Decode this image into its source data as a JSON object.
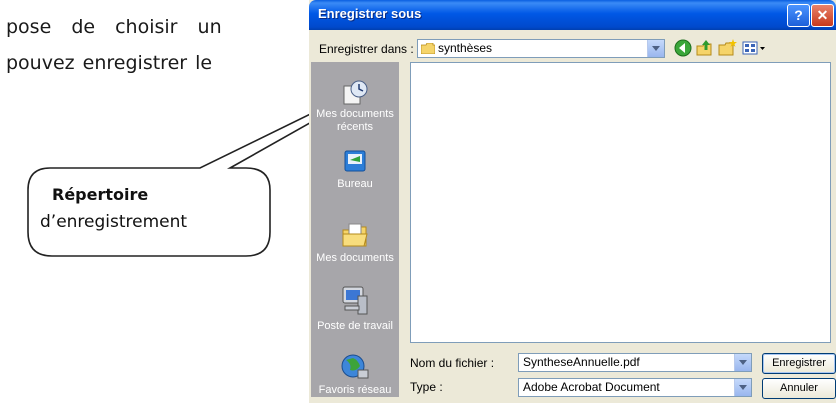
{
  "document": {
    "line1": "pose de choisir un",
    "line2": "pouvez enregistrer le"
  },
  "callout": {
    "title": "Répertoire",
    "subtitle": "d’enregistrement"
  },
  "dialog": {
    "title": "Enregistrer sous",
    "help_label": "?",
    "close_label": "✕",
    "save_in_label": "Enregistrer dans :",
    "location_value": "synthèses",
    "toolbar_icons": [
      "back-icon",
      "up-folder-icon",
      "new-folder-icon",
      "views-menu-icon"
    ],
    "places": [
      {
        "label": "Mes documents récents",
        "icon": "recent-documents-icon"
      },
      {
        "label": "Bureau",
        "icon": "desktop-icon"
      },
      {
        "label": "Mes documents",
        "icon": "my-documents-icon"
      },
      {
        "label": "Poste de travail",
        "icon": "my-computer-icon"
      },
      {
        "label": "Favoris réseau",
        "icon": "network-places-icon"
      }
    ],
    "filename_label": "Nom du fichier :",
    "filename_value": "SyntheseAnnuelle.pdf",
    "type_label": "Type :",
    "type_value": "Adobe Acrobat Document",
    "save_button": "Enregistrer",
    "cancel_button": "Annuler"
  },
  "colors": {
    "titlebar": "#0058e6",
    "dialog_bg": "#ece9d8",
    "places_bg": "#a7a6aa",
    "close": "#c7391c"
  }
}
